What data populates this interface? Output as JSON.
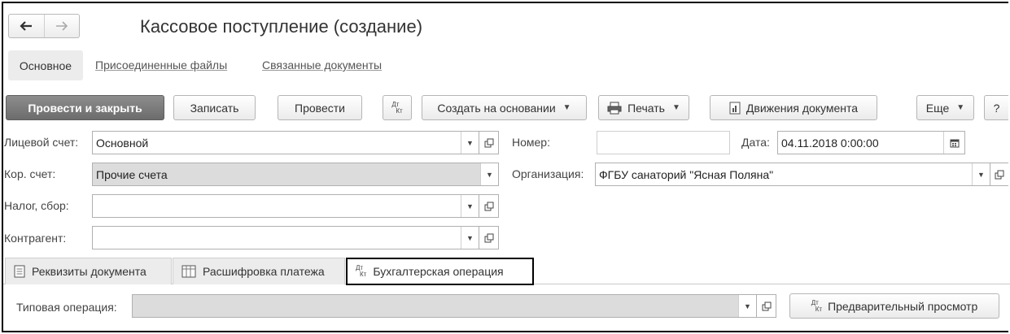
{
  "window": {
    "title": "Кассовое поступление (создание)"
  },
  "nav": {
    "back_icon": "arrow-left-icon",
    "forward_icon": "arrow-right-icon"
  },
  "top_tabs": [
    {
      "label": "Основное",
      "active": true
    },
    {
      "label": "Присоединенные файлы",
      "active": false
    },
    {
      "label": "Связанные документы",
      "active": false
    }
  ],
  "toolbar": {
    "post_close": "Провести и закрыть",
    "save": "Записать",
    "post": "Провести",
    "dtkt_top": "Дт",
    "dtkt_bottom": "Кт",
    "create_based": "Создать на основании",
    "print": "Печать",
    "movements": "Движения документа",
    "more": "Еще",
    "help": "?"
  },
  "form": {
    "account_label": "Лицевой счет:",
    "account_value": "Основной",
    "cor_account_label": "Кор. счет:",
    "cor_account_value": "Прочие счета",
    "tax_label": "Налог, сбор:",
    "tax_value": "",
    "counterparty_label": "Контрагент:",
    "counterparty_value": "",
    "number_label": "Номер:",
    "number_value": "",
    "date_label": "Дата:",
    "date_value": "04.11.2018  0:00:00",
    "org_label": "Организация:",
    "org_value": "ФГБУ санаторий \"Ясная Поляна\""
  },
  "bottom_tabs": [
    {
      "label": "Реквизиты документа",
      "icon": "document-icon",
      "active": false
    },
    {
      "label": "Расшифровка платежа",
      "icon": "table-icon",
      "active": false
    },
    {
      "label": "Бухгалтерская операция",
      "icon": "dt-kt-icon",
      "active": true
    }
  ],
  "operation": {
    "label": "Типовая операция:",
    "value": "",
    "preview": "Предварительный просмотр"
  },
  "colors": {
    "primary_button": "#7a7a7a",
    "active_tab_border": "#000000",
    "gray_field": "#dcdcdc"
  }
}
